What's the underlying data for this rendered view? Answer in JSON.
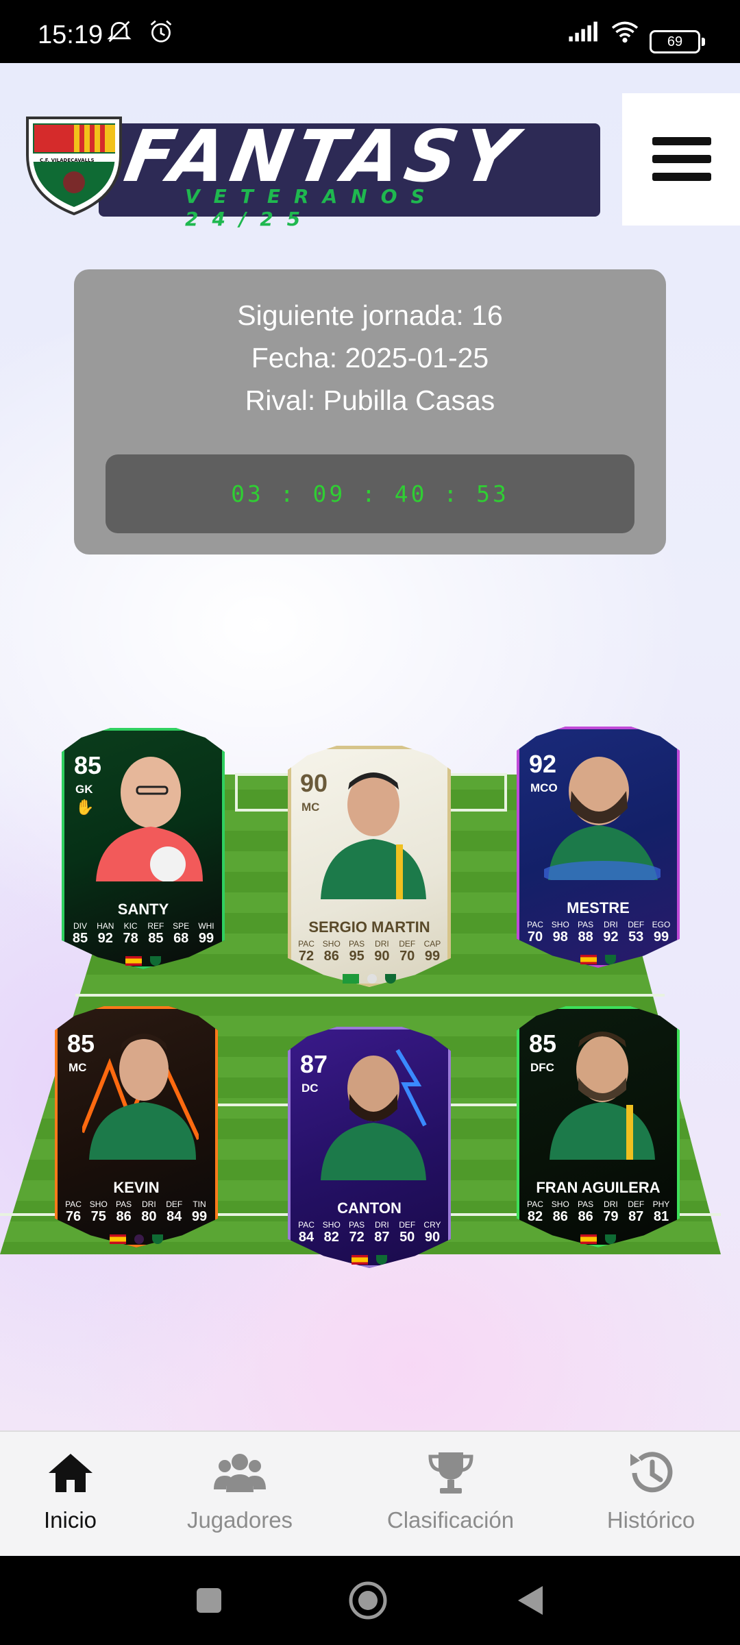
{
  "status_bar": {
    "time": "15:19",
    "battery": "69"
  },
  "header": {
    "logo_title": "FANTASY",
    "logo_subtitle": "VETERANOS 24/25",
    "crest_text": "C.F. VILADECAVALLS"
  },
  "next_match": {
    "jornada_line": "Siguiente jornada: 16",
    "fecha_line": "Fecha: 2025-01-25",
    "rival_line": "Rival: Pubilla Casas",
    "countdown": "03 : 09 : 40 : 53"
  },
  "players": [
    {
      "name": "SANTY",
      "rating": "85",
      "position": "GK",
      "stats": [
        {
          "l": "DIV",
          "v": "85"
        },
        {
          "l": "HAN",
          "v": "92"
        },
        {
          "l": "KIC",
          "v": "78"
        },
        {
          "l": "REF",
          "v": "85"
        },
        {
          "l": "SPE",
          "v": "68"
        },
        {
          "l": "WHI",
          "v": "99"
        }
      ]
    },
    {
      "name": "SERGIO MARTIN",
      "rating": "90",
      "position": "MC",
      "stats": [
        {
          "l": "PAC",
          "v": "72"
        },
        {
          "l": "SHO",
          "v": "86"
        },
        {
          "l": "PAS",
          "v": "95"
        },
        {
          "l": "DRI",
          "v": "90"
        },
        {
          "l": "DEF",
          "v": "70"
        },
        {
          "l": "CAP",
          "v": "99"
        }
      ]
    },
    {
      "name": "MESTRE",
      "rating": "92",
      "position": "MCO",
      "stats": [
        {
          "l": "PAC",
          "v": "70"
        },
        {
          "l": "SHO",
          "v": "98"
        },
        {
          "l": "PAS",
          "v": "88"
        },
        {
          "l": "DRI",
          "v": "92"
        },
        {
          "l": "DEF",
          "v": "53"
        },
        {
          "l": "EGO",
          "v": "99"
        }
      ]
    },
    {
      "name": "KEVIN",
      "rating": "85",
      "position": "MC",
      "stats": [
        {
          "l": "PAC",
          "v": "76"
        },
        {
          "l": "SHO",
          "v": "75"
        },
        {
          "l": "PAS",
          "v": "86"
        },
        {
          "l": "DRI",
          "v": "80"
        },
        {
          "l": "DEF",
          "v": "84"
        },
        {
          "l": "TIN",
          "v": "99"
        }
      ]
    },
    {
      "name": "CANTON",
      "rating": "87",
      "position": "DC",
      "stats": [
        {
          "l": "PAC",
          "v": "84"
        },
        {
          "l": "SHO",
          "v": "82"
        },
        {
          "l": "PAS",
          "v": "72"
        },
        {
          "l": "DRI",
          "v": "87"
        },
        {
          "l": "DEF",
          "v": "50"
        },
        {
          "l": "CRY",
          "v": "90"
        }
      ]
    },
    {
      "name": "FRAN AGUILERA",
      "rating": "85",
      "position": "DFC",
      "stats": [
        {
          "l": "PAC",
          "v": "82"
        },
        {
          "l": "SHO",
          "v": "86"
        },
        {
          "l": "PAS",
          "v": "86"
        },
        {
          "l": "DRI",
          "v": "79"
        },
        {
          "l": "DEF",
          "v": "87"
        },
        {
          "l": "PHY",
          "v": "81"
        }
      ]
    }
  ],
  "bottom_nav": [
    {
      "label": "Inicio",
      "icon": "home-icon",
      "active": true
    },
    {
      "label": "Jugadores",
      "icon": "users-icon",
      "active": false
    },
    {
      "label": "Clasificación",
      "icon": "trophy-icon",
      "active": false
    },
    {
      "label": "Histórico",
      "icon": "history-icon",
      "active": false
    }
  ],
  "colors": {
    "active_nav": "#111111",
    "inactive_nav": "#8c8c8c",
    "countdown_text": "#2fcf33",
    "info_card_bg": "#9a9a9a",
    "pitch_green": "#4f9a2a"
  }
}
